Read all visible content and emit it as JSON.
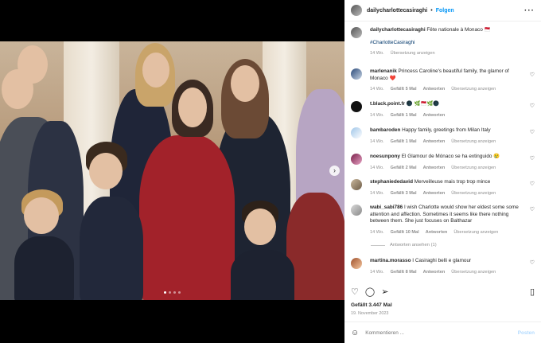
{
  "header": {
    "username": "dailycharlottecasiraghi",
    "separator": "•",
    "follow": "Folgen",
    "more": "···"
  },
  "caption": {
    "username": "dailycharlottecasiraghi",
    "text": "Fête nationale à Monaco 🇲🇨",
    "hashtag": "#CharlotteCasiraghi",
    "age": "14 Wo.",
    "translate": "Übersetzung anzeigen"
  },
  "comments": [
    {
      "user": "marlenanik",
      "text": "Princess Caroline's beautiful family, the glamor of Monaco ❤️",
      "age": "14 Wo.",
      "likes": "Gefällt 5 Mal",
      "reply": "Antworten",
      "translate": "Übersetzung anzeigen"
    },
    {
      "user": "t.black.point.fr",
      "text": "🌑 🌿🇲🇨🌿🌑",
      "age": "14 Wo.",
      "likes": "Gefällt 1 Mal",
      "reply": "Antworten",
      "translate": ""
    },
    {
      "user": "bambaroden",
      "text": "Happy family, greetings from Milan Italy",
      "age": "14 Wo.",
      "likes": "Gefällt 1 Mal",
      "reply": "Antworten",
      "translate": "Übersetzung anzeigen"
    },
    {
      "user": "noesunpony",
      "text": "El Glamour de Mónaco se ha extinguido 😢",
      "age": "14 Wo.",
      "likes": "Gefällt 2 Mal",
      "reply": "Antworten",
      "translate": "Übersetzung anzeigen"
    },
    {
      "user": "stephaniededavid",
      "text": "Merveilleuse mais trop trop mince",
      "age": "14 Wo.",
      "likes": "Gefällt 3 Mal",
      "reply": "Antworten",
      "translate": "Übersetzung anzeigen"
    },
    {
      "user": "wabi_sabi786",
      "text": "I wish Charlotte would show her eldest some some attention and affection. Sometimes it seems like there nothing between them. She just focuses on Balthazar",
      "age": "14 Wo.",
      "likes": "Gefällt 10 Mal",
      "reply": "Antworten",
      "translate": "Übersetzung anzeigen"
    },
    {
      "user": "martina.morasso",
      "text": "I Casiraghi belli e glamour",
      "age": "14 Wo.",
      "likes": "Gefällt 8 Mal",
      "reply": "Antworten",
      "translate": "Übersetzung anzeigen"
    }
  ],
  "view_replies": "Antworten ansehen (1)",
  "likes_total": "Gefällt 3.447 Mal",
  "post_date": "19. November 2023",
  "add_comment": {
    "placeholder": "Kommentieren ...",
    "post": "Posten"
  },
  "icons": {
    "heart": "heart-icon",
    "comment": "comment-icon",
    "share": "share-icon",
    "bookmark": "bookmark-icon",
    "emoji": "emoji-icon"
  },
  "colors": {
    "link": "#0095f6",
    "hashtag": "#00376b",
    "muted": "#8e8e8e"
  }
}
